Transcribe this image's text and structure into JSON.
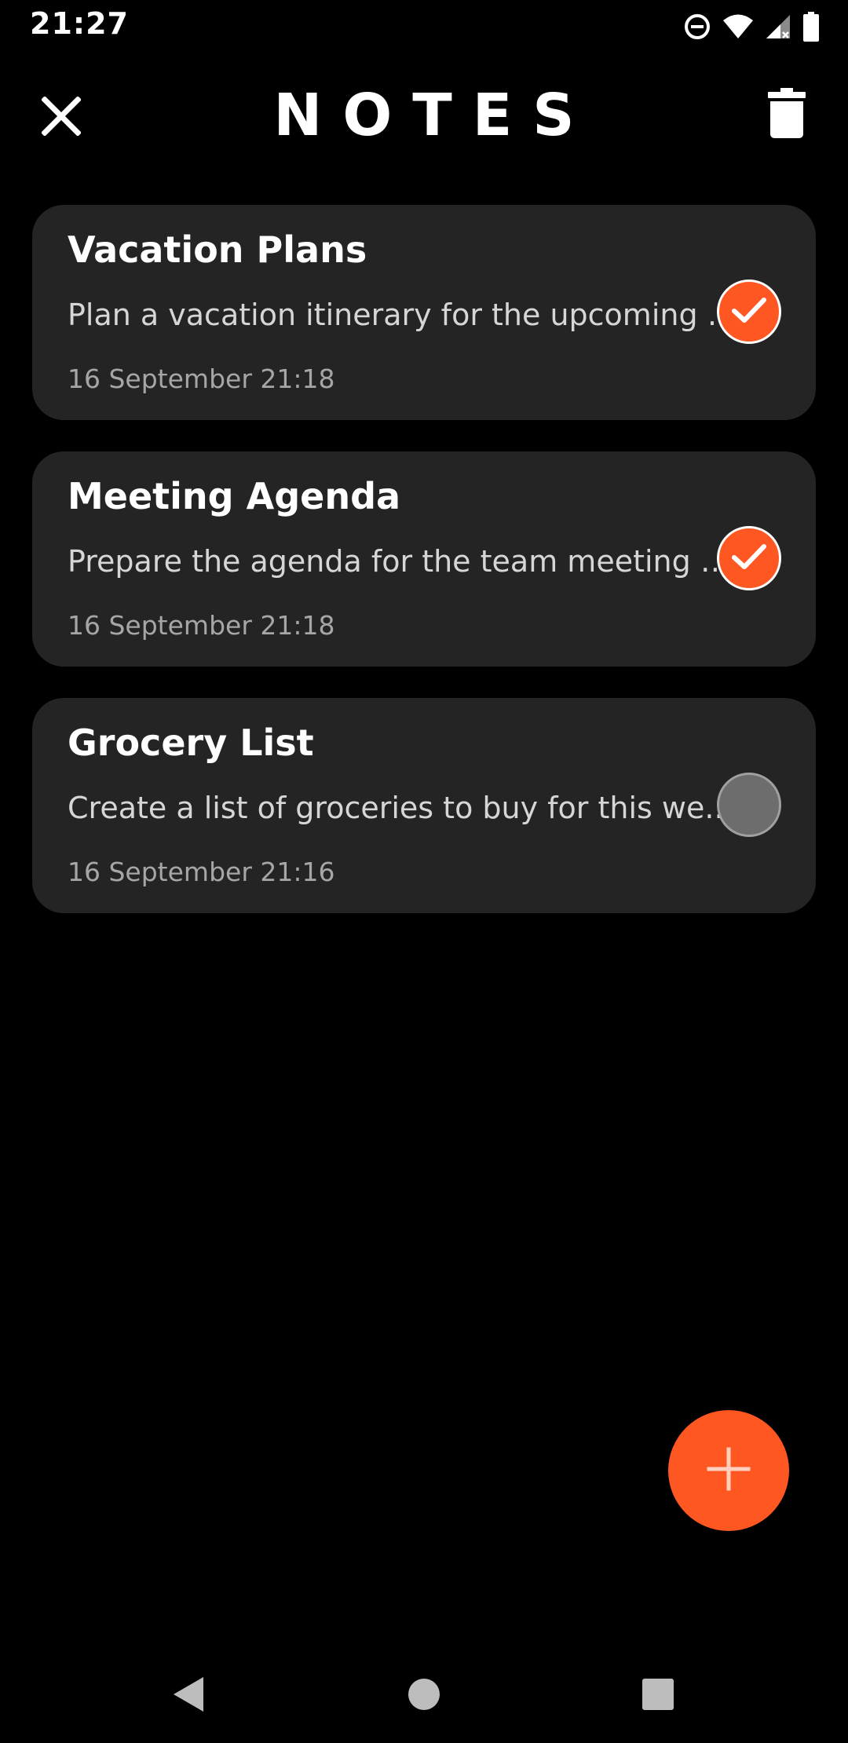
{
  "status_bar": {
    "time": "21:27",
    "icons": [
      "do-not-disturb-icon",
      "wifi-icon",
      "signal-icon",
      "battery-icon"
    ]
  },
  "app_bar": {
    "title": "NOTES",
    "close_icon": "close-icon",
    "delete_icon": "trash-icon"
  },
  "notes": [
    {
      "title": "Vacation Plans",
      "body": "Plan a vacation itinerary for the upcoming t...",
      "date": "16 September 21:18",
      "done": true
    },
    {
      "title": "Meeting Agenda",
      "body": "Prepare the agenda for the team meeting s...",
      "date": "16 September 21:18",
      "done": true
    },
    {
      "title": "Grocery List",
      "body": "Create a list of groceries to buy for this we...",
      "date": "16 September 21:16",
      "done": false
    }
  ],
  "fab": {
    "icon": "plus-icon"
  },
  "nav_bar": {
    "icons": [
      "back-icon",
      "home-icon",
      "recents-icon"
    ]
  },
  "colors": {
    "accent": "#ff5722",
    "card": "#242424",
    "background": "#000000",
    "pending": "#6d6d6d"
  }
}
